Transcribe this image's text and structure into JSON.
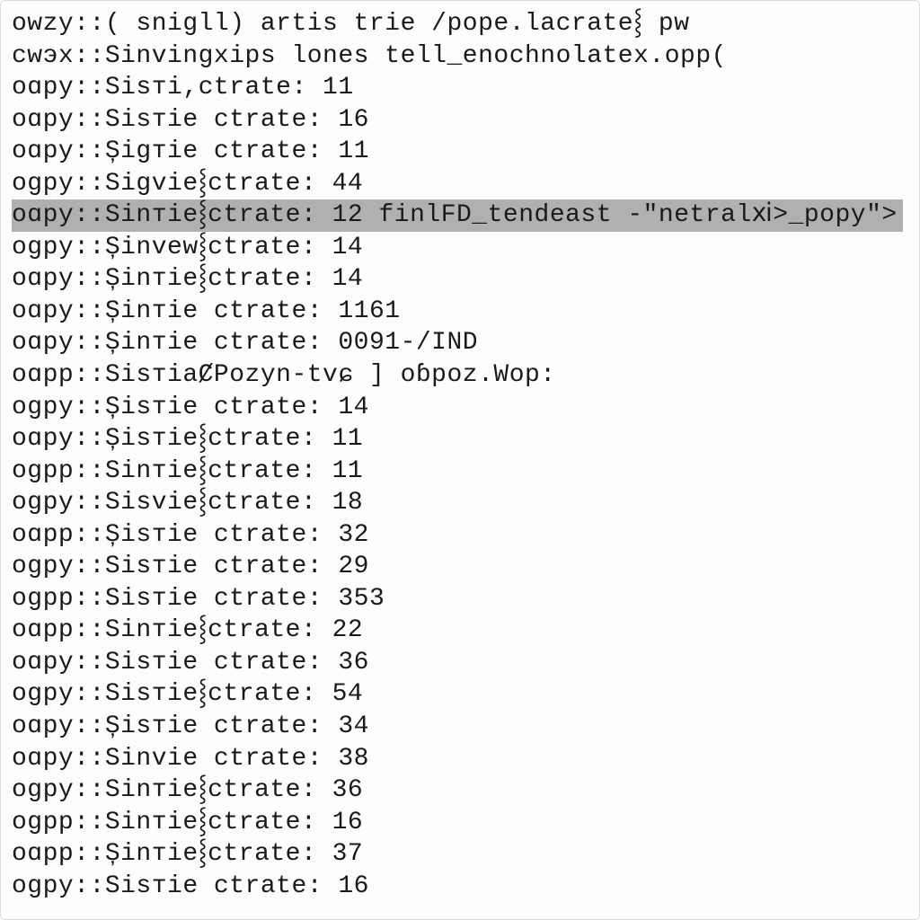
{
  "lines": [
    {
      "text": "owzy::( snigll) artis trie /pope.lacrate⸾ pw",
      "highlighted": false
    },
    {
      "text": "cwэx::Sinvingxips lones tell_enochnolatex.opp(",
      "highlighted": false
    },
    {
      "text": "oɑpy::Sisтi,ctrate: 11",
      "highlighted": false
    },
    {
      "text": "oɑpy::Sisтie ctrate: 16",
      "highlighted": false
    },
    {
      "text": "oɑpy::Șigтie ctrate: 11",
      "highlighted": false
    },
    {
      "text": "ogpy::Sigvie⸾ctrate: 44",
      "highlighted": false
    },
    {
      "text": "oɑpy::Sinтie⸾ctrate: 12 finlFD_tendeast -\"netralⅺ>_popy\">",
      "highlighted": true
    },
    {
      "text": "ogpy::Șinvew⸾ctrate: 14",
      "highlighted": false
    },
    {
      "text": "oɑpy::Șinтie⸾ctrate: 14",
      "highlighted": false
    },
    {
      "text": "oɑpy::Șinтie ctrate: 1161",
      "highlighted": false
    },
    {
      "text": "oɑpy::Șinтie ctrate: 0091-/IND",
      "highlighted": false
    },
    {
      "text": "oɑpp::SisтiaȻPozyn-tvɕ ] oɓpoz.Wop:",
      "highlighted": false
    },
    {
      "text": "ogpy::Șisтie ctrate: 14",
      "highlighted": false
    },
    {
      "text": "oɑpy::Șisтie⸾ctrate: 11",
      "highlighted": false
    },
    {
      "text": "ogpp::Sinтie⸾ctrate: 11",
      "highlighted": false
    },
    {
      "text": "ogpy::Sisvie⸾ctrate: 18",
      "highlighted": false
    },
    {
      "text": "oɑpp::Șisтie ctrate: 32",
      "highlighted": false
    },
    {
      "text": "ogpy::Sisтie ctrate: 29",
      "highlighted": false
    },
    {
      "text": "ogpp::Sisтie ctrate: 353",
      "highlighted": false
    },
    {
      "text": "oɑpp::Sinтie⸾ctrate: 22",
      "highlighted": false
    },
    {
      "text": "oɑpy::Sisтie ctrate: 36",
      "highlighted": false
    },
    {
      "text": "ogpy::Sisтie⸾ctrate: 54",
      "highlighted": false
    },
    {
      "text": "oɑpy::Șisтie ctrate: 34",
      "highlighted": false
    },
    {
      "text": "oɑpy::Sinvie ctrate: 38",
      "highlighted": false
    },
    {
      "text": "ogpy::Sinтie⸾ctrate: 36",
      "highlighted": false
    },
    {
      "text": "ogpp::Sinтie⸾ctrate: 16",
      "highlighted": false
    },
    {
      "text": "oɑpp::Șinтie⸾ctrate: 37",
      "highlighted": false
    },
    {
      "text": "ogpy::Sisтie ctrate: 16",
      "highlighted": false
    }
  ]
}
